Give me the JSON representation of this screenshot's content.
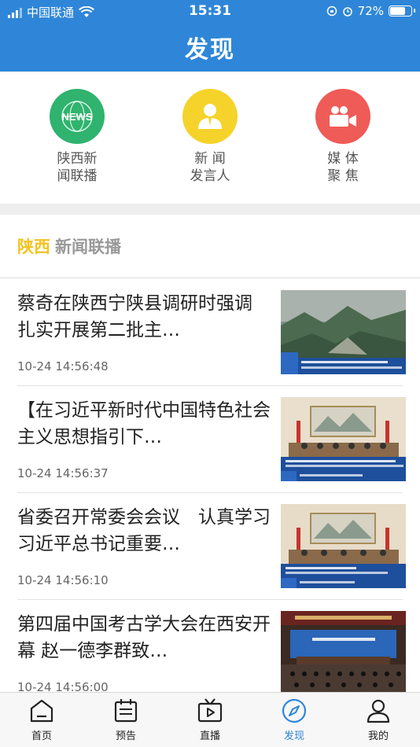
{
  "status": {
    "carrier": "中国联通",
    "time": "15:31",
    "battery": "72%",
    "battery_level": 0.72
  },
  "header": {
    "title": "发现"
  },
  "features": [
    {
      "label": "陕西新\n闻联播",
      "icon": "news-icon",
      "icon_text": "NEWS",
      "color": "#2fb36e"
    },
    {
      "label": "新 闻\n发言人",
      "icon": "spokesperson-icon",
      "color": "#f5d32a"
    },
    {
      "label": "媒 体\n聚 焦",
      "icon": "video-camera-icon",
      "color": "#ef5b57"
    }
  ],
  "section": {
    "title_accent": "陕西",
    "title_rest": "新闻联播"
  },
  "news": [
    {
      "title": "蔡奇在陕西宁陕县调研时强调 扎实开展第二批主…",
      "time": "10-24 14:56:48"
    },
    {
      "title": "【在习近平新时代中国特色社会主义思想指引下…",
      "time": "10-24 14:56:37"
    },
    {
      "title": "省委召开常委会会议　认真学习习近平总书记重要…",
      "time": "10-24 14:56:10"
    },
    {
      "title": "第四届中国考古学大会在西安开幕 赵一德李群致…",
      "time": "10-24 14:56:00"
    }
  ],
  "tabs": [
    {
      "label": "首页",
      "icon": "home-icon",
      "active": false
    },
    {
      "label": "预告",
      "icon": "calendar-icon",
      "active": false
    },
    {
      "label": "直播",
      "icon": "tv-icon",
      "active": false
    },
    {
      "label": "发现",
      "icon": "compass-icon",
      "active": true
    },
    {
      "label": "我的",
      "icon": "user-icon",
      "active": false
    }
  ],
  "colors": {
    "brand": "#2f86d8",
    "accent": "#f3c323"
  }
}
